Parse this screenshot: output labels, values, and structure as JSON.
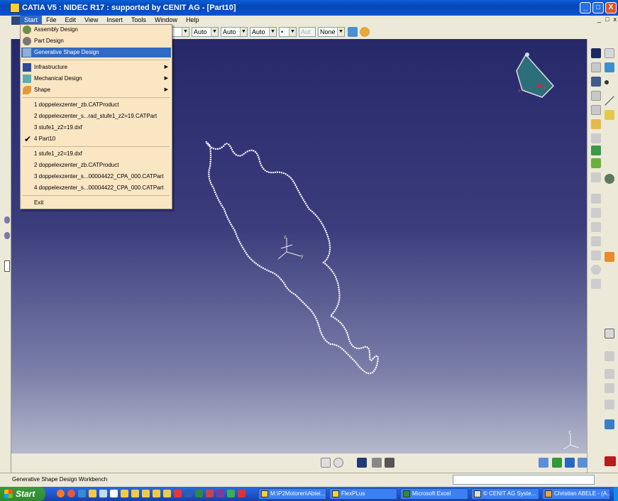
{
  "window": {
    "title": "CATIA V5 : NIDEC R17 : supported by CENIT AG - [Part10]",
    "controls": {
      "minimize": "_",
      "maximize": "□",
      "close": "X"
    }
  },
  "menubar": {
    "items": [
      "Start",
      "File",
      "Edit",
      "View",
      "Insert",
      "Tools",
      "Window",
      "Help"
    ],
    "doc_controls": [
      "_",
      "□",
      "x"
    ]
  },
  "toolbar": {
    "combos": [
      "Auto",
      "Auto",
      "Auto",
      "•",
      "Aut",
      "None"
    ]
  },
  "start_menu": {
    "workbenches": [
      {
        "label": "Assembly Design",
        "icon": "assembly-icon"
      },
      {
        "label": "Part Design",
        "icon": "gear-icon"
      },
      {
        "label": "Generative Shape Design",
        "icon": "shape-icon"
      }
    ],
    "submenus": [
      {
        "label": "Infrastructure",
        "icon": "infrastructure-icon"
      },
      {
        "label": "Mechanical Design",
        "icon": "mechanical-icon"
      },
      {
        "label": "Shape",
        "icon": "shape-wave-icon"
      }
    ],
    "recent_docs": [
      "1 doppelexzenter_zb.CATProduct",
      "2 doppelexzenter_s...rad_stufe1_z2=19.CATPart",
      "3 stufe1_z2=19.dxf",
      "4 Part10"
    ],
    "recent_files": [
      "1 stufe1_z2=19.dxf",
      "2 doppelexzenter_zb.CATProduct",
      "3 doppelexzenter_s...00004422_CPA_000.CATPart",
      "4 doppelexzenter_s...00004422_CPA_000.CATPart"
    ],
    "exit": "Exit"
  },
  "viewport": {
    "axis_labels": {
      "x": "x",
      "y": "y",
      "z": "z"
    }
  },
  "statusbar": {
    "text": "Generative Shape Design Workbench"
  },
  "taskbar": {
    "start": "Start",
    "tasks": [
      "M:\\P2Motoren\\Abtei...",
      "FlexPLus",
      "Microsoft Excel",
      "© CENIT AG Syste...",
      "Christian ABELE - (A..."
    ]
  },
  "colors": {
    "highlight": "#316ac5",
    "menu_bg": "#fbe6c4",
    "viewport_top": "#27286a",
    "viewport_bottom": "#b5b9cc"
  }
}
